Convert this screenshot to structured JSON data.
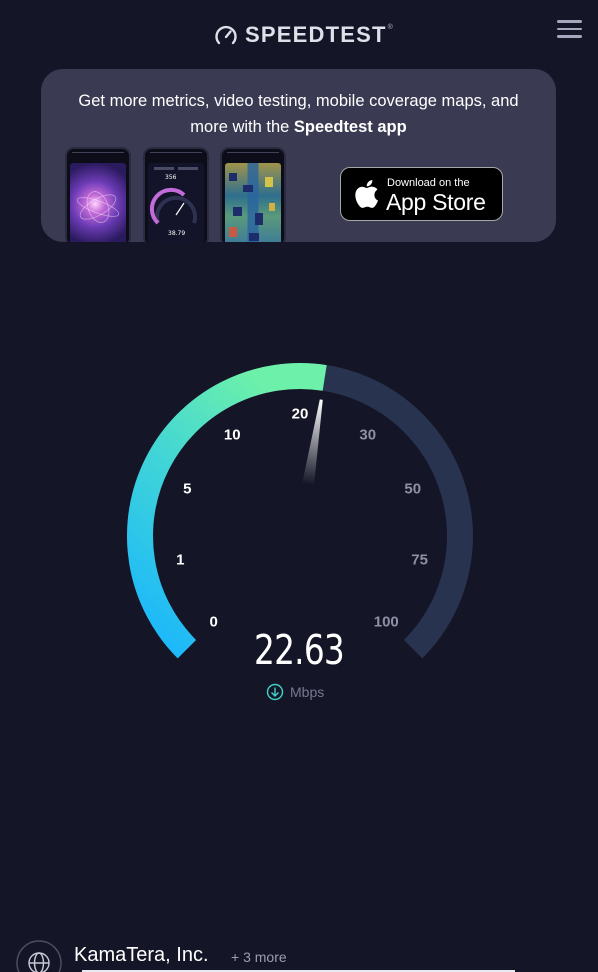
{
  "header": {
    "logo_text": "SPEEDTEST",
    "logo_tm": "®",
    "menu_icon": "hamburger-menu-icon"
  },
  "banner": {
    "text_line1": "Get more metrics, video testing, mobile coverage maps, and",
    "text_line2_prefix": "more with the ",
    "text_line2_bold": "Speedtest app",
    "app_store_small": "Download on the",
    "app_store_big": "App Store"
  },
  "gauge": {
    "scale_labels": [
      "0",
      "1",
      "5",
      "10",
      "20",
      "30",
      "50",
      "75",
      "100"
    ],
    "current_value": 22.63,
    "current_value_text": "22.63",
    "unit": "Mbps",
    "colors": {
      "progress_start": "#1bb6ff",
      "progress_end": "#5de8b0",
      "track": "#28344f",
      "background": "#141526"
    }
  },
  "provider": {
    "name": "KamaTera, Inc.",
    "more": "+ 3 more"
  }
}
